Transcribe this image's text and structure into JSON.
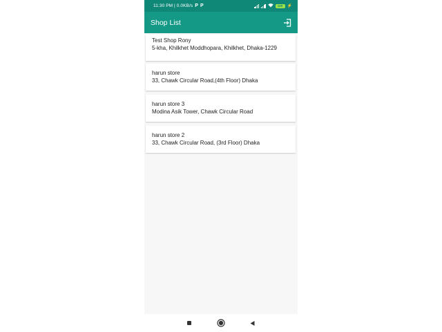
{
  "status_bar": {
    "time_speed": "11:30 PM | 0.0KB/s",
    "notif_icons": [
      "P",
      "P"
    ],
    "battery": "100"
  },
  "app_bar": {
    "title": "Shop List",
    "logout_icon": "logout-icon"
  },
  "shops": [
    {
      "name": "Test Shop Rony",
      "address": "5-kha, Khilkhet Moddhopara, Khilkhet, Dhaka-1229"
    },
    {
      "name": "harun store",
      "address": "33, Chawk Circular Road,(4th Floor) Dhaka"
    },
    {
      "name": "harun store 3",
      "address": "Modina Asik Tower, Chawk Circular Road"
    },
    {
      "name": "harun store 2",
      "address": "33, Chawk Circular Road, (3rd Floor) Dhaka"
    }
  ],
  "colors": {
    "primary": "#149987",
    "primary_dark": "#0f8878",
    "background": "#f7f7f7"
  }
}
